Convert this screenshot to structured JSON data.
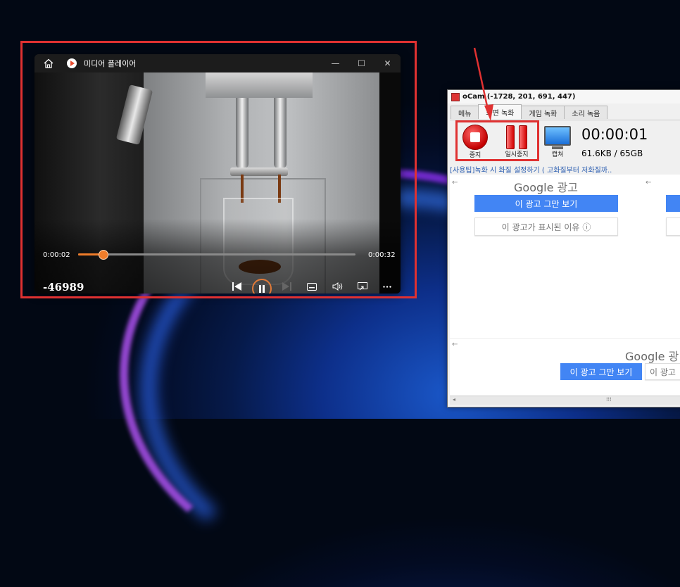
{
  "media_player": {
    "window_title": "미디어 플레이어",
    "window_controls": {
      "minimize": "—",
      "maximize": "☐",
      "close": "✕"
    },
    "elapsed": "0:00:02",
    "duration": "0:00:32",
    "progress": 0.09,
    "counter": "-46989"
  },
  "ocam": {
    "title": "oCam (-1728, 201, 691, 447)",
    "tabs": [
      "메뉴",
      "화면 녹화",
      "게임 녹화",
      "소리 녹음"
    ],
    "active_tab": "화면 녹화",
    "buttons": {
      "stop": "중지",
      "pause": "일시중지",
      "capture": "캡쳐"
    },
    "timer": "00:00:01",
    "file_size": "61.6KB / 65GB",
    "tip": "[사용팁]녹화 시 화질 설정하기 ( 고화질부터 저화질까..",
    "ad": {
      "brand": "Google",
      "brand_suffix": "광고",
      "brand_suffix_partial": "광",
      "stop_ad": "이 광고 그만 보기",
      "why_ad": "이 광고가 표시된 이유",
      "why_ad_partial": "이 광고",
      "back": "←",
      "info": "ⓘ"
    },
    "scroll_left": "◂",
    "scroll_mid": "⁞⁞⁞"
  },
  "colors": {
    "highlight": "#e03131",
    "accent_orange": "#f07d2a",
    "google_blue": "#4285f4"
  }
}
